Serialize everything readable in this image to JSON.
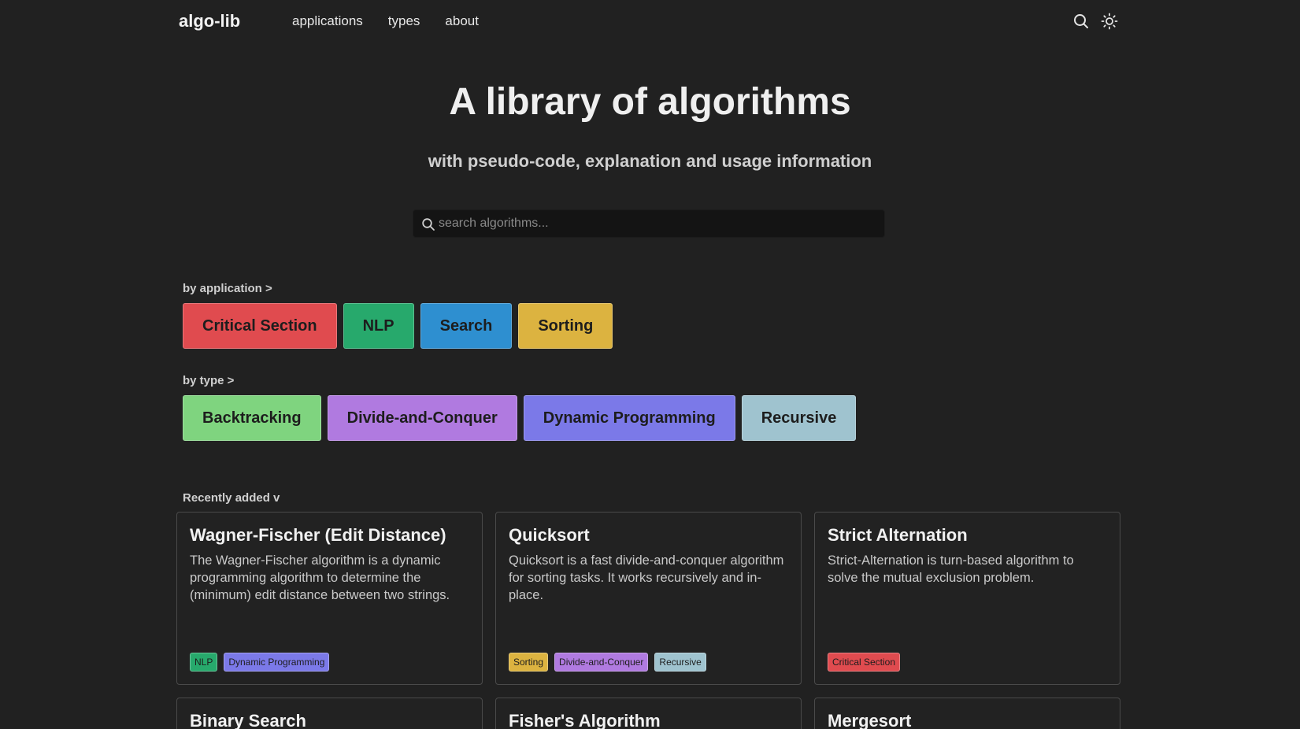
{
  "nav": {
    "logo": "algo-lib",
    "links": [
      "applications",
      "types",
      "about"
    ],
    "icons": [
      "search-icon",
      "sun-icon"
    ]
  },
  "hero": {
    "title": "A library of algorithms",
    "subtitle": "with pseudo-code, explanation and usage information"
  },
  "search": {
    "placeholder": "search algorithms..."
  },
  "by_application": {
    "label": "by application >",
    "items": [
      {
        "label": "Critical Section",
        "color": "#e04b4f"
      },
      {
        "label": "NLP",
        "color": "#27a96c"
      },
      {
        "label": "Search",
        "color": "#2e8fd0"
      },
      {
        "label": "Sorting",
        "color": "#dcb340"
      }
    ]
  },
  "by_type": {
    "label": "by type >",
    "items": [
      {
        "label": "Backtracking",
        "color": "#7fd47f"
      },
      {
        "label": "Divide-and-Conquer",
        "color": "#b07ae0"
      },
      {
        "label": "Dynamic Programming",
        "color": "#7b79e8"
      },
      {
        "label": "Recursive",
        "color": "#9fc3cf"
      }
    ]
  },
  "recent": {
    "label": "Recently added v",
    "cards": [
      {
        "title": "Wagner-Fischer (Edit Distance)",
        "desc": "The Wagner-Fischer algorithm is a dynamic programming algorithm to determine the (minimum) edit distance between two strings.",
        "tags": [
          {
            "label": "NLP",
            "color": "#27a96c"
          },
          {
            "label": "Dynamic Programming",
            "color": "#7b79e8"
          }
        ]
      },
      {
        "title": "Quicksort",
        "desc": "Quicksort is a fast divide-and-conquer algorithm for sorting tasks. It works recursively and in-place.",
        "tags": [
          {
            "label": "Sorting",
            "color": "#dcb340"
          },
          {
            "label": "Divide-and-Conquer",
            "color": "#b07ae0"
          },
          {
            "label": "Recursive",
            "color": "#9fc3cf"
          }
        ]
      },
      {
        "title": "Strict Alternation",
        "desc": "Strict-Alternation is turn-based algorithm to solve the mutual exclusion problem.",
        "tags": [
          {
            "label": "Critical Section",
            "color": "#e04b4f"
          }
        ]
      },
      {
        "title": "Binary Search",
        "desc": "",
        "tags": []
      },
      {
        "title": "Fisher's Algorithm",
        "desc": "",
        "tags": []
      },
      {
        "title": "Mergesort",
        "desc": "",
        "tags": []
      }
    ]
  }
}
